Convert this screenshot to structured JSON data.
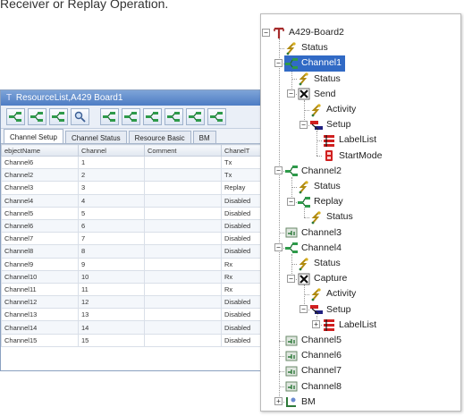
{
  "caption": "Receiver or Replay Operation.",
  "resource_window": {
    "title": "ResourceList,A429 Board1",
    "tabs": [
      "Channel Setup",
      "Channel Status",
      "Resource Basic",
      "BM"
    ],
    "columns": [
      "ebjectName",
      "Channel",
      "Comment",
      "ChanelT"
    ],
    "rows": [
      [
        "Channel6",
        "1",
        "",
        "Tx"
      ],
      [
        "Channel2",
        "2",
        "",
        "Tx"
      ],
      [
        "Channel3",
        "3",
        "",
        "Replay"
      ],
      [
        "Channel4",
        "4",
        "",
        "Disabled"
      ],
      [
        "Channel5",
        "5",
        "",
        "Disabled"
      ],
      [
        "Channel6",
        "6",
        "",
        "Disabled"
      ],
      [
        "Channel7",
        "7",
        "",
        "Disabled"
      ],
      [
        "Channel8",
        "8",
        "",
        "Disabled"
      ],
      [
        "Channel9",
        "9",
        "",
        "Rx"
      ],
      [
        "Channel10",
        "10",
        "",
        "Rx"
      ],
      [
        "Channel11",
        "11",
        "",
        "Rx"
      ],
      [
        "Channel12",
        "12",
        "",
        "Disabled"
      ],
      [
        "Channel13",
        "13",
        "",
        "Disabled"
      ],
      [
        "Channel14",
        "14",
        "",
        "Disabled"
      ],
      [
        "Channel15",
        "15",
        "",
        "Disabled"
      ]
    ]
  },
  "tree": {
    "nodes": [
      {
        "label": "A429-Board2",
        "icon": "board-icon"
      },
      {
        "label": "Status",
        "icon": "status-icon"
      },
      {
        "label": "Channel1",
        "icon": "channel-icon",
        "selected": true
      },
      {
        "label": "Status",
        "icon": "status-icon"
      },
      {
        "label": "Send",
        "icon": "send-icon"
      },
      {
        "label": "Activity",
        "icon": "status-icon"
      },
      {
        "label": "Setup",
        "icon": "setup-icon"
      },
      {
        "label": "LabelList",
        "icon": "labellist-icon"
      },
      {
        "label": "StartMode",
        "icon": "startmode-icon"
      },
      {
        "label": "Channel2",
        "icon": "channel-icon"
      },
      {
        "label": "Status",
        "icon": "status-icon"
      },
      {
        "label": "Replay",
        "icon": "channel-icon"
      },
      {
        "label": "Status",
        "icon": "status-icon"
      },
      {
        "label": "Channel3",
        "icon": "channel-disabled-icon"
      },
      {
        "label": "Channel4",
        "icon": "channel-icon"
      },
      {
        "label": "Status",
        "icon": "status-icon"
      },
      {
        "label": "Capture",
        "icon": "send-icon"
      },
      {
        "label": "Activity",
        "icon": "status-icon"
      },
      {
        "label": "Setup",
        "icon": "setup-icon"
      },
      {
        "label": "LabelList",
        "icon": "labellist-icon"
      },
      {
        "label": "Channel5",
        "icon": "channel-disabled-icon"
      },
      {
        "label": "Channel6",
        "icon": "channel-disabled-icon"
      },
      {
        "label": "Channel7",
        "icon": "channel-disabled-icon"
      },
      {
        "label": "Channel8",
        "icon": "channel-disabled-icon"
      },
      {
        "label": "BM",
        "icon": "bm-icon"
      }
    ]
  },
  "colors": {
    "selection": "#316ac5",
    "title_bar": "#4d7cc4",
    "channel_green": "#2e9a4a",
    "setup_red": "#d02020"
  }
}
